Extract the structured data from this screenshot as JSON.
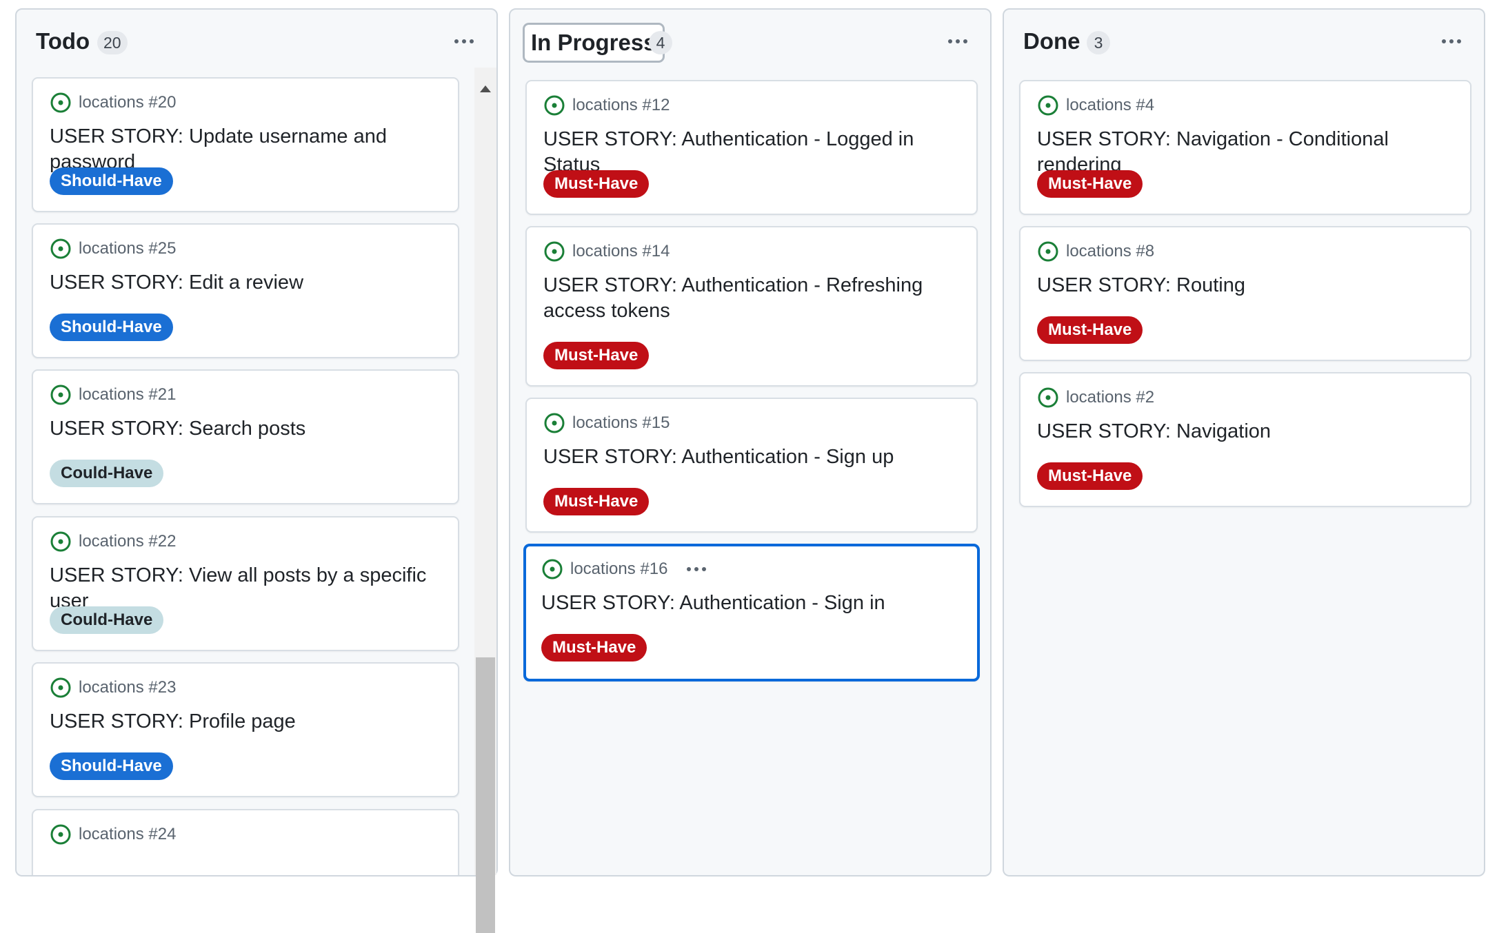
{
  "columns": [
    {
      "title": "Todo",
      "count": "20",
      "cards": [
        {
          "repo_ref": "locations #20",
          "title": "USER STORY: Update username and password",
          "label": "Should-Have"
        },
        {
          "repo_ref": "locations #25",
          "title": "USER STORY: Edit a review",
          "label": "Should-Have"
        },
        {
          "repo_ref": "locations #21",
          "title": "USER STORY: Search posts",
          "label": "Could-Have"
        },
        {
          "repo_ref": "locations #22",
          "title": "USER STORY: View all posts by a specific user",
          "label": "Could-Have"
        },
        {
          "repo_ref": "locations #23",
          "title": "USER STORY: Profile page",
          "label": "Should-Have"
        },
        {
          "repo_ref": "locations #24",
          "title": "",
          "label": ""
        }
      ]
    },
    {
      "title": "In Progress",
      "count": "4",
      "cards": [
        {
          "repo_ref": "locations #12",
          "title": "USER STORY: Authentication - Logged in Status",
          "label": "Must-Have"
        },
        {
          "repo_ref": "locations #14",
          "title": "USER STORY: Authentication - Refreshing access tokens",
          "label": "Must-Have"
        },
        {
          "repo_ref": "locations #15",
          "title": "USER STORY: Authentication - Sign up",
          "label": "Must-Have"
        },
        {
          "repo_ref": "locations #16",
          "title": "USER STORY: Authentication - Sign in",
          "label": "Must-Have"
        }
      ]
    },
    {
      "title": "Done",
      "count": "3",
      "cards": [
        {
          "repo_ref": "locations #4",
          "title": "USER STORY: Navigation - Conditional rendering",
          "label": "Must-Have"
        },
        {
          "repo_ref": "locations #8",
          "title": "USER STORY: Routing",
          "label": "Must-Have"
        },
        {
          "repo_ref": "locations #2",
          "title": "USER STORY: Navigation",
          "label": "Must-Have"
        }
      ]
    }
  ],
  "colors": {
    "open_issue": "#1a7f37",
    "should_have": "#1a6fd4",
    "could_have": "#c4dde2",
    "must_have": "#c00f16",
    "selected_border": "#0969da"
  },
  "icons": {
    "issue": "issue-opened-icon",
    "menu": "kebab-horizontal-icon",
    "scroll_up": "triangle-up-icon"
  }
}
